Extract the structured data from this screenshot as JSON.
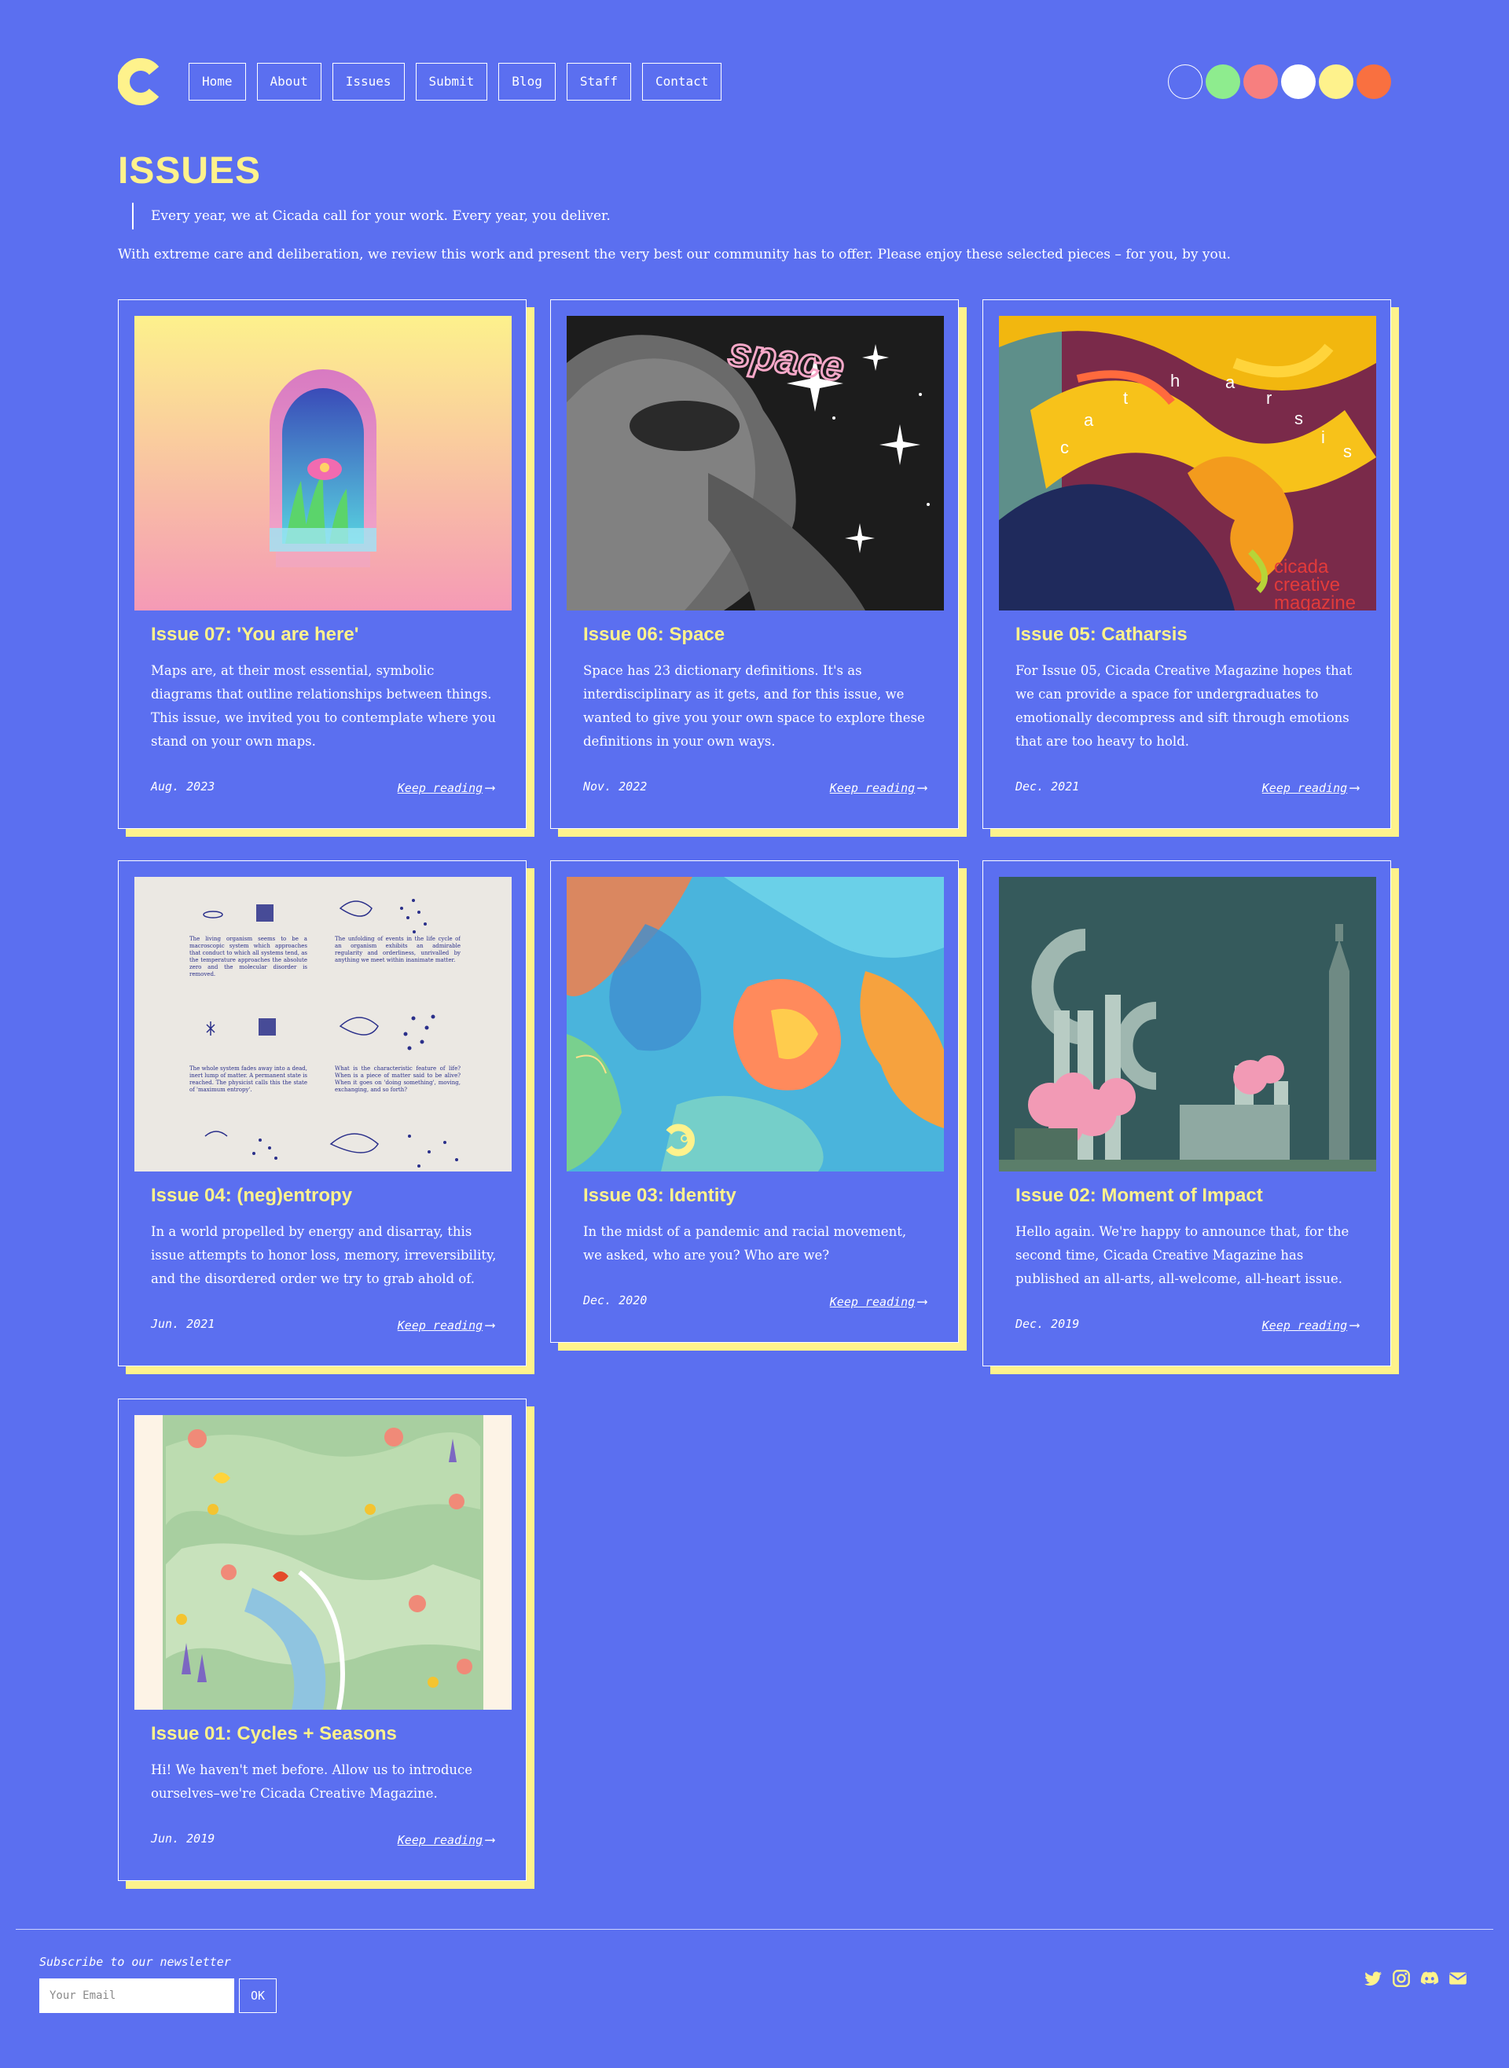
{
  "nav": {
    "items": [
      "Home",
      "About",
      "Issues",
      "Submit",
      "Blog",
      "Staff",
      "Contact"
    ]
  },
  "theme_swatches": [
    "#5b6ff0",
    "#8eec8e",
    "#f77f7f",
    "#ffffff",
    "#fef28c",
    "#f97040"
  ],
  "colors": {
    "background": "#5b6ff0",
    "accent": "#fef28c",
    "text": "#ffffff"
  },
  "page": {
    "title": "ISSUES",
    "quote": "Every year, we at Cicada call for your work. Every year, you deliver.",
    "lead": "With extreme care and deliberation, we review this work and present the very best our community has to offer. Please enjoy these selected pieces – for you, by you."
  },
  "issues": [
    {
      "title": "Issue 07: 'You are here'",
      "desc": "Maps are, at their most essential, symbolic diagrams that outline relationships between things. This issue, we invited you to contemplate where you stand on your own maps.",
      "date": "Aug. 2023",
      "link": "Keep reading"
    },
    {
      "title": "Issue 06: Space",
      "desc": "Space has 23 dictionary definitions. It's as interdisciplinary as it gets, and for this issue, we wanted to give you your own space to explore these definitions in your own ways.",
      "date": "Nov. 2022",
      "link": "Keep reading",
      "cover_text": "space"
    },
    {
      "title": "Issue 05: Catharsis",
      "desc": "For Issue 05, Cicada Creative Magazine hopes that we can provide a space for undergraduates to emotionally decompress and sift through emotions that are too heavy to hold.",
      "date": "Dec. 2021",
      "link": "Keep reading",
      "cover_text": [
        "c",
        "a",
        "t",
        "h",
        "a",
        "r",
        "s",
        "i",
        "s"
      ],
      "cover_brand": [
        "cicada",
        "creative",
        "magazine"
      ]
    },
    {
      "title": "Issue 04: (neg)entropy",
      "desc": "In a world propelled by energy and disarray, this issue attempts to honor loss, memory, irreversibility, and the disordered order we try to grab ahold of.",
      "date": "Jun. 2021",
      "link": "Keep reading",
      "cover_paragraphs": [
        "The living organism seems to be a macroscopic system which approaches that conduct to which all systems tend, as the temperature approaches the absolute zero and the molecular disorder is removed.",
        "The unfolding of events in the life cycle of an organism exhibits an admirable regularity and orderliness, unrivalled by anything we meet within inanimate matter.",
        "The whole system fades away into a dead, inert lump of matter. A permanent state is reached. The physicist calls this the state of 'maximum entropy'.",
        "What is the characteristic feature of life? When is a piece of matter said to be alive? When it goes on 'doing something', moving, exchanging, and so forth?"
      ]
    },
    {
      "title": "Issue 03: Identity",
      "desc": "In the midst of a pandemic and racial movement, we asked, who are you? Who are we?",
      "date": "Dec. 2020",
      "link": "Keep reading"
    },
    {
      "title": "Issue 02: Moment of Impact",
      "desc": "Hello again. We're happy to announce that, for the second time, Cicada Creative Magazine has published an all-arts, all-welcome, all-heart issue.",
      "date": "Dec. 2019",
      "link": "Keep reading"
    },
    {
      "title": "Issue 01: Cycles + Seasons",
      "desc": "Hi! We haven't met before. Allow us to introduce ourselves–we're Cicada Creative Magazine.",
      "date": "Jun. 2019",
      "link": "Keep reading"
    }
  ],
  "footer": {
    "subscribe_label": "Subscribe to our newsletter",
    "email_placeholder": "Your Email",
    "ok_label": "OK",
    "social_icons": [
      "twitter-icon",
      "instagram-icon",
      "discord-icon",
      "mail-icon"
    ]
  }
}
